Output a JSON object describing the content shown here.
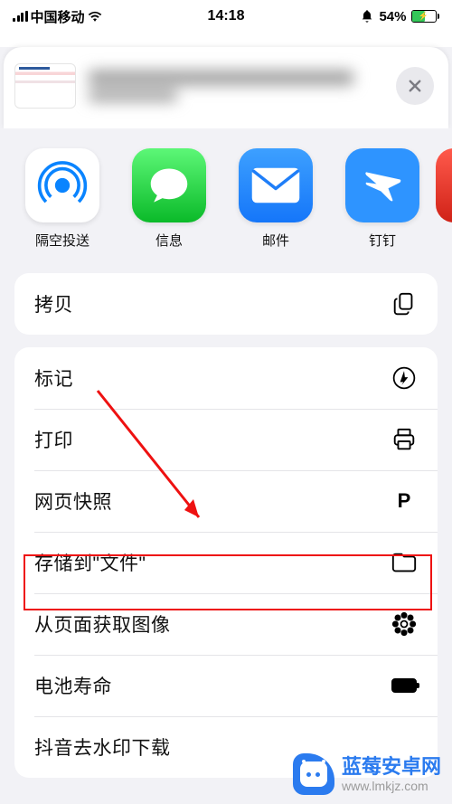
{
  "status": {
    "carrier": "中国移动",
    "time": "14:18",
    "batteryPercent": "54%",
    "batteryFill": 54
  },
  "shareApps": {
    "airdrop": "隔空投送",
    "messages": "信息",
    "mail": "邮件",
    "dingtalk": "钉钉"
  },
  "actions": {
    "copy": "拷贝",
    "markup": "标记",
    "print": "打印",
    "snapshot": "网页快照",
    "saveToFiles": "存储到\"文件\"",
    "getImages": "从页面获取图像",
    "batteryLife": "电池寿命",
    "douyin": "抖音去水印下载"
  },
  "watermark": {
    "title": "蓝莓安卓网",
    "url": "www.lmkjz.com"
  }
}
